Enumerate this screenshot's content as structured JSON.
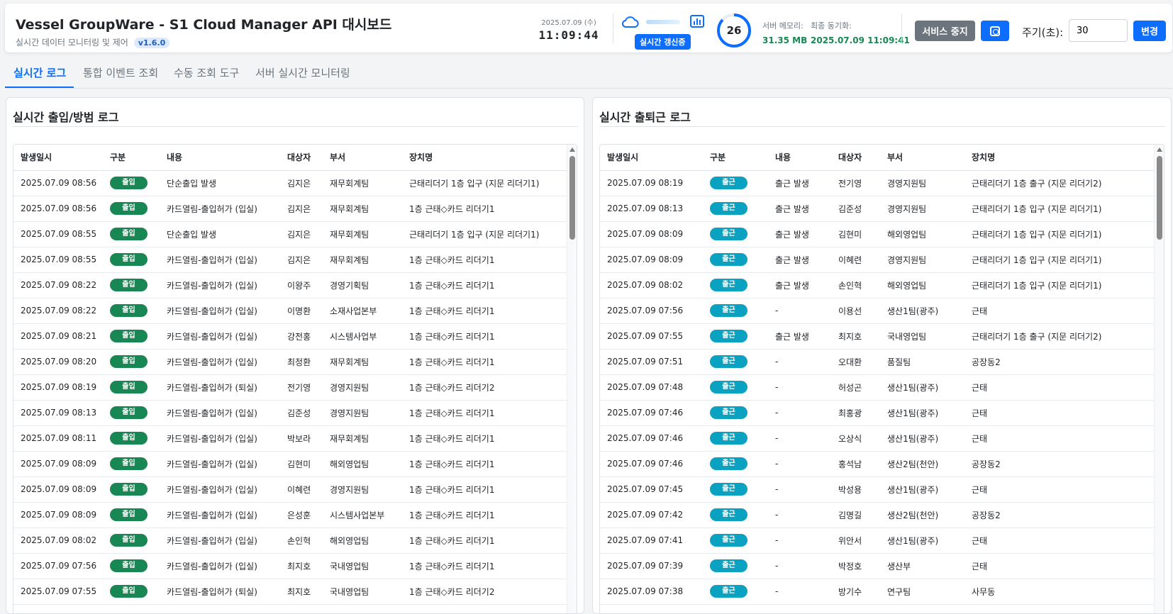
{
  "app": {
    "title": "Vessel GroupWare - S1 Cloud Manager API 대시보드",
    "subtitle": "실시간 데이터 모니터링 및 제어",
    "version": "v1.6.0"
  },
  "clock": {
    "date": "2025.07.09 (수)",
    "time": "11:09:44"
  },
  "status": {
    "live_label": "실시간 갱신중",
    "countdown": "26",
    "memory_label": "서버 메모리:",
    "memory_value": "31.35 MB",
    "sync_label": "최종 동기화:",
    "sync_value": "2025.07.09 11:09:41"
  },
  "controls": {
    "stop_label": "서비스 중지",
    "period_label": "주기(초):",
    "period_value": "30",
    "apply_label": "변경"
  },
  "tabs": [
    "실시간 로그",
    "통합 이벤트 조회",
    "수동 조회 도구",
    "서버 실시간 모니터링"
  ],
  "left_panel": {
    "title": "실시간 출입/방범 로그",
    "columns": [
      "발생일시",
      "구분",
      "내용",
      "대상자",
      "부서",
      "장치명"
    ],
    "rows": [
      [
        "2025.07.09 08:56",
        "출입",
        "단순출입 발생",
        "김지은",
        "재무회계팀",
        "근태리더기 1층 입구 (지문 리더기1)"
      ],
      [
        "2025.07.09 08:56",
        "출입",
        "카드열림-출입허가 (입실)",
        "김지은",
        "재무회계팀",
        "1층 근태◇카드 리더기1"
      ],
      [
        "2025.07.09 08:55",
        "출입",
        "단순출입 발생",
        "김지은",
        "재무회계팀",
        "근태리더기 1층 입구 (지문 리더기1)"
      ],
      [
        "2025.07.09 08:55",
        "출입",
        "카드열림-출입허가 (입실)",
        "김지은",
        "재무회계팀",
        "1층 근태◇카드 리더기1"
      ],
      [
        "2025.07.09 08:22",
        "출입",
        "카드열림-출입허가 (입실)",
        "이왕주",
        "경영기획팀",
        "1층 근태◇카드 리더기1"
      ],
      [
        "2025.07.09 08:22",
        "출입",
        "카드열림-출입허가 (입실)",
        "이명환",
        "소재사업본부",
        "1층 근태◇카드 리더기1"
      ],
      [
        "2025.07.09 08:21",
        "출입",
        "카드열림-출입허가 (입실)",
        "강전홍",
        "시스템사업부",
        "1층 근태◇카드 리더기1"
      ],
      [
        "2025.07.09 08:20",
        "출입",
        "카드열림-출입허가 (입실)",
        "최정환",
        "재무회계팀",
        "1층 근태◇카드 리더기1"
      ],
      [
        "2025.07.09 08:19",
        "출입",
        "카드열림-출입허가 (퇴실)",
        "전기영",
        "경영지원팀",
        "1층 근태◇카드 리더기2"
      ],
      [
        "2025.07.09 08:13",
        "출입",
        "카드열림-출입허가 (입실)",
        "김준성",
        "경영지원팀",
        "1층 근태◇카드 리더기1"
      ],
      [
        "2025.07.09 08:11",
        "출입",
        "카드열림-출입허가 (입실)",
        "박보라",
        "재무회계팀",
        "1층 근태◇카드 리더기1"
      ],
      [
        "2025.07.09 08:09",
        "출입",
        "카드열림-출입허가 (입실)",
        "김현미",
        "해외영업팀",
        "1층 근태◇카드 리더기1"
      ],
      [
        "2025.07.09 08:09",
        "출입",
        "카드열림-출입허가 (입실)",
        "이혜련",
        "경영지원팀",
        "1층 근태◇카드 리더기1"
      ],
      [
        "2025.07.09 08:09",
        "출입",
        "카드열림-출입허가 (입실)",
        "은성훈",
        "시스템사업본부",
        "1층 근태◇카드 리더기1"
      ],
      [
        "2025.07.09 08:02",
        "출입",
        "카드열림-출입허가 (입실)",
        "손인혁",
        "해외영업팀",
        "1층 근태◇카드 리더기1"
      ],
      [
        "2025.07.09 07:56",
        "출입",
        "카드열림-출입허가 (입실)",
        "최지호",
        "국내영업팀",
        "1층 근태◇카드 리더기1"
      ],
      [
        "2025.07.09 07:55",
        "출입",
        "카드열림-출입허가 (퇴실)",
        "최지호",
        "국내영업팀",
        "1층 근태◇카드 리더기2"
      ]
    ]
  },
  "right_panel": {
    "title": "실시간 출퇴근 로그",
    "columns": [
      "발생일시",
      "구분",
      "내용",
      "대상자",
      "부서",
      "장치명"
    ],
    "rows": [
      [
        "2025.07.09 08:19",
        "출근",
        "출근 발생",
        "전기영",
        "경영지원팀",
        "근태리더기 1층 출구 (지문 리더기2)"
      ],
      [
        "2025.07.09 08:13",
        "출근",
        "출근 발생",
        "김준성",
        "경영지원팀",
        "근태리더기 1층 입구 (지문 리더기1)"
      ],
      [
        "2025.07.09 08:09",
        "출근",
        "출근 발생",
        "김현미",
        "해외영업팀",
        "근태리더기 1층 입구 (지문 리더기1)"
      ],
      [
        "2025.07.09 08:09",
        "출근",
        "출근 발생",
        "이혜련",
        "경영지원팀",
        "근태리더기 1층 입구 (지문 리더기1)"
      ],
      [
        "2025.07.09 08:02",
        "출근",
        "출근 발생",
        "손인혁",
        "해외영업팀",
        "근태리더기 1층 입구 (지문 리더기1)"
      ],
      [
        "2025.07.09 07:56",
        "출근",
        "-",
        "이용선",
        "생산1팀(광주)",
        "근태"
      ],
      [
        "2025.07.09 07:55",
        "출근",
        "출근 발생",
        "최지호",
        "국내영업팀",
        "근태리더기 1층 출구 (지문 리더기2)"
      ],
      [
        "2025.07.09 07:51",
        "출근",
        "-",
        "오대환",
        "품질팀",
        "공장동2"
      ],
      [
        "2025.07.09 07:48",
        "출근",
        "-",
        "허성곤",
        "생산1팀(광주)",
        "근태"
      ],
      [
        "2025.07.09 07:46",
        "출근",
        "-",
        "최홍광",
        "생산1팀(광주)",
        "근태"
      ],
      [
        "2025.07.09 07:46",
        "출근",
        "-",
        "오상식",
        "생산1팀(광주)",
        "근태"
      ],
      [
        "2025.07.09 07:46",
        "출근",
        "-",
        "홍석남",
        "생산2팀(천안)",
        "공장동2"
      ],
      [
        "2025.07.09 07:45",
        "출근",
        "-",
        "박성용",
        "생산1팀(광주)",
        "근태"
      ],
      [
        "2025.07.09 07:42",
        "출근",
        "-",
        "김명길",
        "생산2팀(천안)",
        "공장동2"
      ],
      [
        "2025.07.09 07:41",
        "출근",
        "-",
        "위안서",
        "생산1팀(광주)",
        "근태"
      ],
      [
        "2025.07.09 07:39",
        "출근",
        "-",
        "박정호",
        "생산부",
        "근태"
      ],
      [
        "2025.07.09 07:38",
        "출근",
        "-",
        "방기수",
        "연구팀",
        "사무동"
      ]
    ]
  },
  "colors": {
    "accent": "#0d6efd",
    "badge_entry": "#198754",
    "badge_commute": "#0aa2c0",
    "stat_value": "#198754"
  }
}
